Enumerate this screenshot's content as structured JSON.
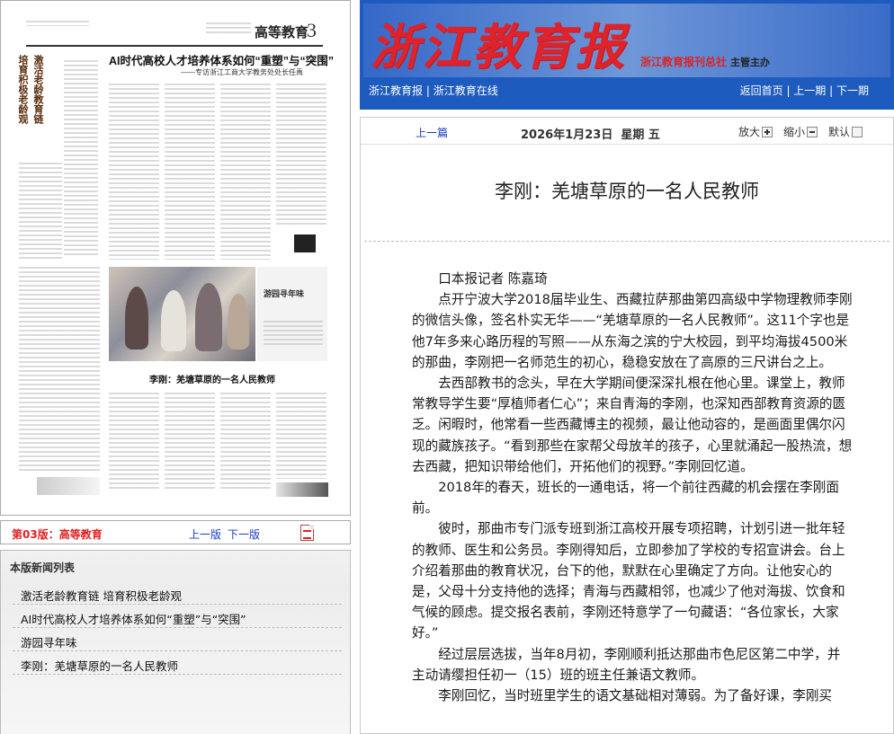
{
  "site": {
    "masthead": "浙江教育报",
    "publisher": "浙江教育报刊总社",
    "publisher_role": "主管主办",
    "nav_left": [
      "浙江教育报",
      "浙江教育在线"
    ],
    "nav_right": [
      "返回首页",
      "上一期",
      "下一期"
    ]
  },
  "newspaper_page": {
    "section": "高等教育",
    "page_number": "3",
    "headline": "AI时代高校人才培养体系如何“重塑”与“突围”",
    "subhead": "——专访浙江工商大学教务处处长任禹",
    "vertical_title_1": "激活老龄教育链",
    "vertical_title_2": "培育积极老龄观",
    "photo_caption": "游园寻年味",
    "story_title": "李刚：羌塘草原的一名人民教师"
  },
  "page_nav": {
    "page_label": "第03版：高等教育",
    "prev": "上一版",
    "next": "下一版",
    "pdf_icon": "pdf-icon"
  },
  "news_list": {
    "title": "本版新闻列表",
    "items": [
      "激活老龄教育链 培育积极老龄观",
      "AI时代高校人才培养体系如何“重塑”与“突围”",
      "游园寻年味",
      "李刚：羌塘草原的一名人民教师"
    ]
  },
  "toolbar": {
    "prev_article": "上一篇",
    "date": "2026年1月23日  星期 五",
    "zoom_in": "放大",
    "zoom_out": "缩小",
    "zoom_default": "默认"
  },
  "article": {
    "title": "李刚：羌塘草原的一名人民教师",
    "paragraphs": [
      "口本报记者 陈嘉琦",
      "点开宁波大学2018届毕业生、西藏拉萨那曲第四高级中学物理教师李刚的微信头像，签名朴实无华——“羌塘草原的一名人民教师”。这11个字也是他7年多来心路历程的写照——从东海之滨的宁大校园，到平均海拔4500米的那曲，李刚把一名师范生的初心，稳稳安放在了高原的三尺讲台之上。",
      "去西部教书的念头，早在大学期间便深深扎根在他心里。课堂上，教师常教导学生要“厚植师者仁心”；来自青海的李刚，也深知西部教育资源的匮乏。闲暇时，他常看一些西藏博主的视频，最让他动容的，是画面里偶尔闪现的藏族孩子。“看到那些在家帮父母放羊的孩子，心里就涌起一股热流，想去西藏，把知识带给他们，开拓他们的视野。”李刚回忆道。",
      "2018年的春天，班长的一通电话，将一个前往西藏的机会摆在李刚面前。",
      "彼时，那曲市专门派专班到浙江高校开展专项招聘，计划引进一批年轻的教师、医生和公务员。李刚得知后，立即参加了学校的专招宣讲会。台上介绍着那曲的教育状况，台下的他，默默在心里确定了方向。让他安心的是，父母十分支持他的选择；青海与西藏相邻，也减少了他对海拔、饮食和气候的顾虑。提交报名表前，李刚还特意学了一句藏语：“各位家长，大家好。”",
      "经过层层选拔，当年8月初，李刚顺利抵达那曲市色尼区第二中学，并主动请缨担任初一（15）班的班主任兼语文教师。",
      "李刚回忆，当时班里学生的语文基础相对薄弱。为了备好课，李刚买"
    ]
  }
}
